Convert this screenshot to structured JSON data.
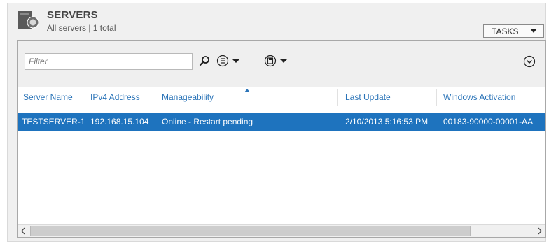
{
  "header": {
    "title": "SERVERS",
    "subtitle": "All servers | 1 total",
    "tasks_label": "TASKS"
  },
  "toolbar": {
    "filter_placeholder": "Filter",
    "icons": [
      "search-icon",
      "view-options-icon",
      "save-query-icon",
      "expand-icon"
    ]
  },
  "table": {
    "columns": [
      "Server Name",
      "IPv4 Address",
      "Manageability",
      "Last Update",
      "Windows Activation"
    ],
    "sorted_column": "Manageability",
    "rows": [
      {
        "server_name": "TESTSERVER-1",
        "ipv4": "192.168.15.104",
        "manageability": "Online - Restart pending",
        "last_update": "2/10/2013 5:16:53 PM",
        "activation": "00183-90000-00001-AA"
      }
    ]
  },
  "colors": {
    "accent": "#1e73be",
    "header_text": "#2b74b8",
    "panel_bg": "#f0f0f0"
  }
}
